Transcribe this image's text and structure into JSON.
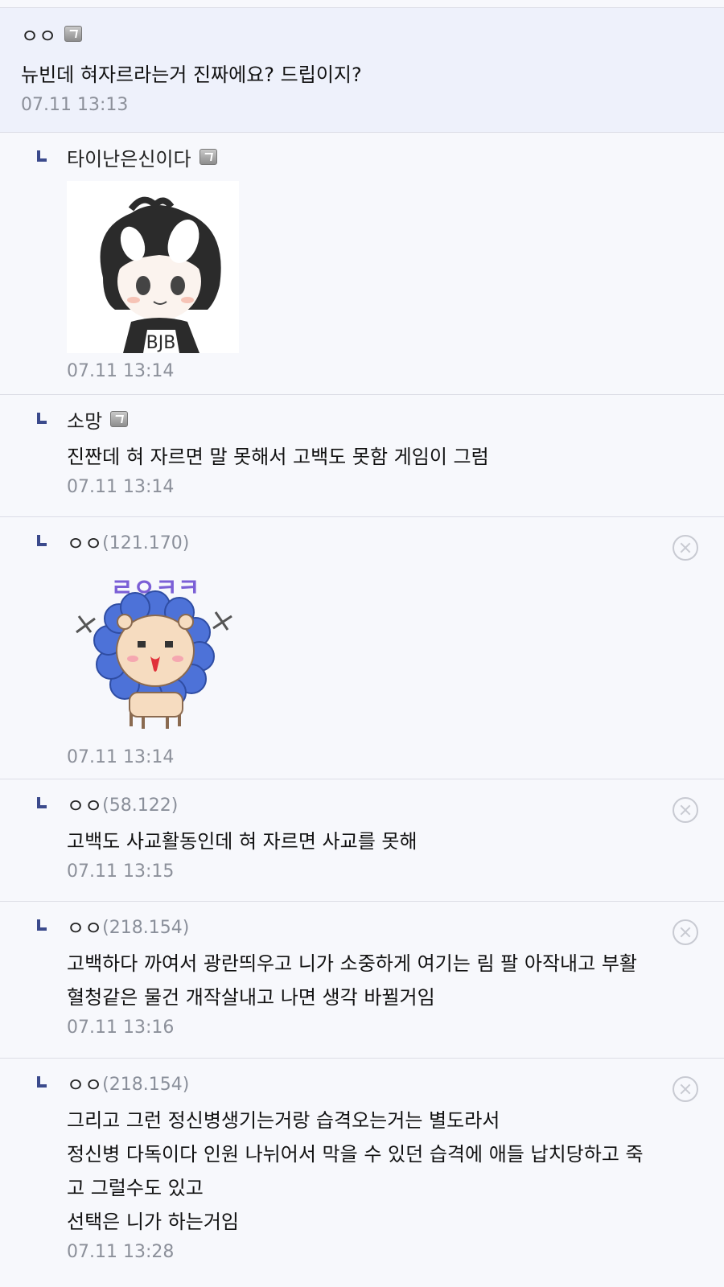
{
  "main_comment": {
    "nick": "ㅇㅇ",
    "text": "뉴빈데 혀자르라는거 진짜에요? 드립이지?",
    "time": "07.11 13:13"
  },
  "replies": [
    {
      "nick": "타이난은신이다",
      "ip": "",
      "text": "",
      "time": "07.11 13:14",
      "sticker": "chibi-character-sticker"
    },
    {
      "nick": "소망",
      "ip": "",
      "text": "진짠데 혀 자르면 말 못해서 고백도 못함 게임이 그럼",
      "time": "07.11 13:14"
    },
    {
      "nick": "ㅇㅇ",
      "ip": "(121.170)",
      "text": "",
      "time": "07.11 13:14",
      "sticker": "lion-sticker",
      "sticker_text": "ㄹㅇㅋㅋ"
    },
    {
      "nick": "ㅇㅇ",
      "ip": "(58.122)",
      "text": "고백도 사교활동인데 혀 자르면 사교를 못해",
      "time": "07.11 13:15"
    },
    {
      "nick": "ㅇㅇ",
      "ip": "(218.154)",
      "lines": [
        "고백하다 까여서 광란띄우고 니가 소중하게 여기는 림 팔 아작내고 부활",
        "혈청같은 물건 개작살내고 나면 생각 바뀔거임"
      ],
      "time": "07.11 13:16"
    },
    {
      "nick": "ㅇㅇ",
      "ip": "(218.154)",
      "lines": [
        "그리고 그런 정신병생기는거랑 습격오는거는 별도라서",
        "정신병 다독이다 인원 나뉘어서 막을 수 있던 습격에 애들 납치당하고 죽",
        "고 그럴수도 있고",
        "선택은 니가 하는거임"
      ],
      "time": "07.11 13:28"
    }
  ],
  "colors": {
    "accent": "#3b4a8c",
    "main_bg": "#eef1fb",
    "timestamp": "#8c909a"
  }
}
